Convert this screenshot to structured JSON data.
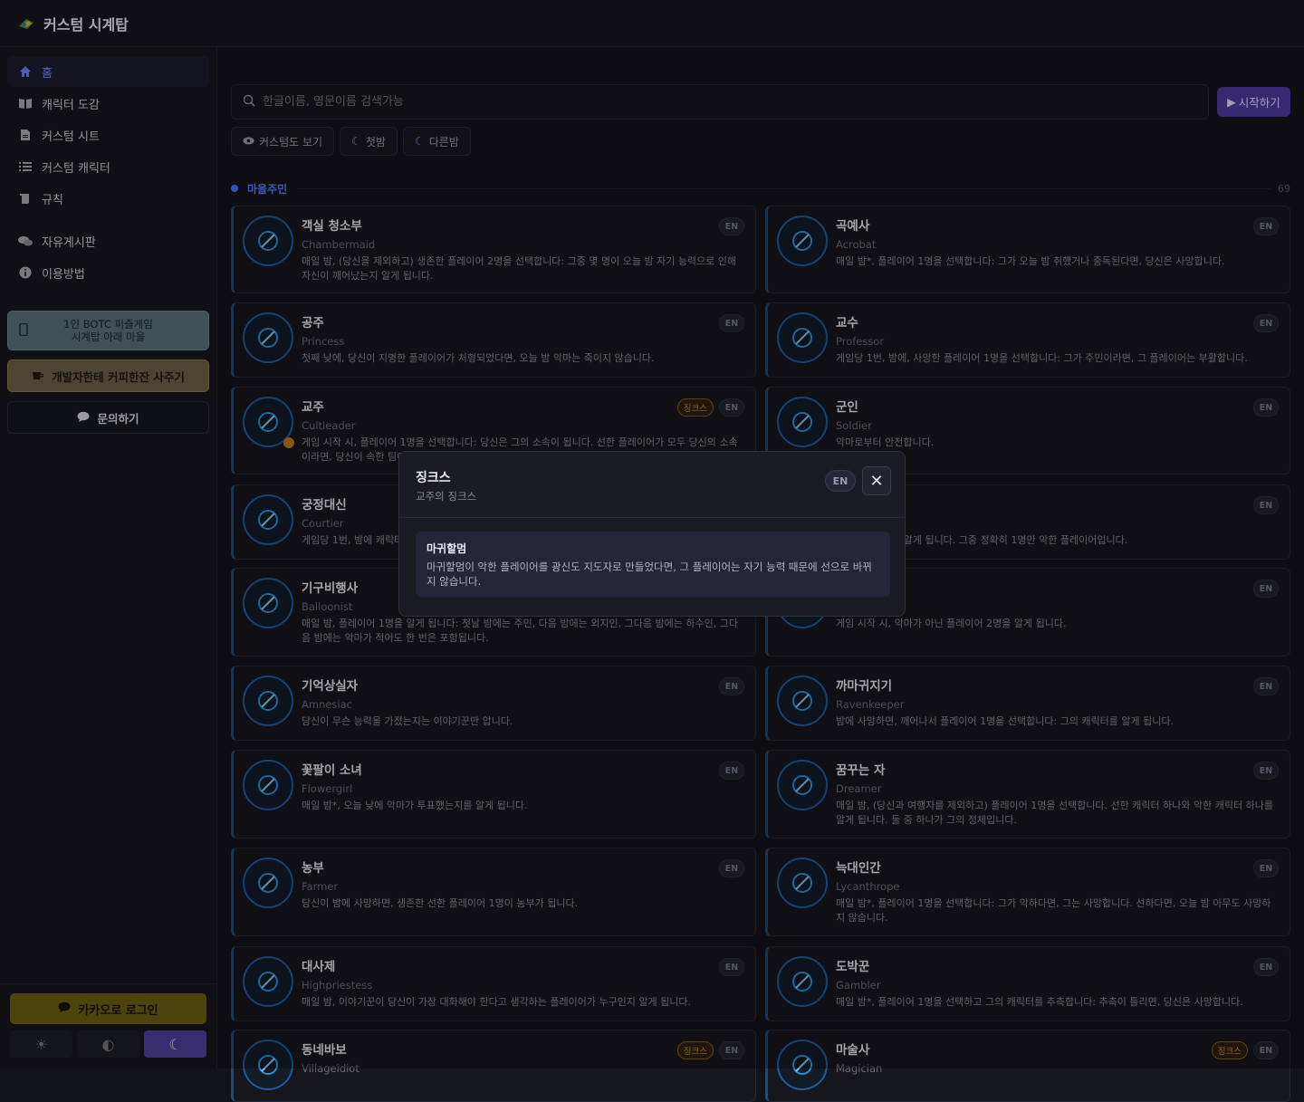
{
  "app": {
    "title": "커스텀 시계탑"
  },
  "sidebar": {
    "items": [
      {
        "label": "홈",
        "icon": "home-icon"
      },
      {
        "label": "캐릭터 도감",
        "icon": "book-icon"
      },
      {
        "label": "커스텀 시트",
        "icon": "document-icon"
      },
      {
        "label": "커스텀 캐릭터",
        "icon": "list-icon"
      },
      {
        "label": "규칙",
        "icon": "scroll-icon"
      },
      {
        "label": "자유게시판",
        "icon": "chat-icon"
      },
      {
        "label": "이용방법",
        "icon": "info-icon"
      }
    ],
    "promo1_line1": "1인 BOTC 퍼즐게임",
    "promo1_line2": "시계탑 아래 마을",
    "promo2": "개발자한테 커피한잔 사주기",
    "promo3": "문의하기",
    "kakao_login": "카카오로 로그인"
  },
  "search": {
    "placeholder": "한글이름, 영문이름 검색가능"
  },
  "start_button": "시작하기",
  "filters": [
    "커스텀도 보기",
    "첫밤",
    "다른밤"
  ],
  "section": {
    "label": "마을주민",
    "count": "69"
  },
  "cards": [
    {
      "name": "객실 청소부",
      "en": "Chambermaid",
      "desc": "매일 밤, (당신을 제외하고) 생존한 플레이어 2명을 선택합니다: 그중 몇 명이 오늘 밤 자기 능력으로 인해 자신이 깨어났는지 알게 됩니다.",
      "jinx": ""
    },
    {
      "name": "곡예사",
      "en": "Acrobat",
      "desc": "매일 밤*, 플레이어 1명을 선택합니다: 그가 오늘 밤 취했거나 중독된다면, 당신은 사망합니다.",
      "jinx": ""
    },
    {
      "name": "공주",
      "en": "Princess",
      "desc": "첫째 낮에, 당신이 지명한 플레이어가 처형되었다면, 오늘 밤 악마는 죽이지 않습니다.",
      "jinx": ""
    },
    {
      "name": "교수",
      "en": "Professor",
      "desc": "게임당 1번, 밤에, 사망한 플레이어 1명을 선택합니다: 그가 주민이라면, 그 플레이어는 부활합니다.",
      "jinx": ""
    },
    {
      "name": "교주",
      "en": "Cultleader",
      "desc": "게임 시작 시, 플레이어 1명을 선택합니다: 당신은 그의 소속이 됩니다. 선한 플레이어가 모두 당신의 소속 이라면, 당신이 속한 팀이",
      "jinx": "징크스"
    },
    {
      "name": "군인",
      "en": "Soldier",
      "desc": "악마로부터 안전합니다.",
      "jinx": ""
    },
    {
      "name": "궁정대신",
      "en": "Courtier",
      "desc": "게임당 1번, 밤에 캐릭터",
      "jinx": ""
    },
    {
      "name": "",
      "en": "",
      "desc": "플레이어 3명을 알게 됩니다. 그중 정확히 1명만 악한 플레이어입니다.",
      "jinx": ""
    },
    {
      "name": "기구비행사",
      "en": "Balloonist",
      "desc": "매일 밤, 플레이어 1명을 알게 됩니다: 첫날 밤에는 주민, 다음 밤에는 외지인, 그다음 밤에는 하수인, 그다 음 밤에는 악마가 적어도 한 번은 포함됩니다.",
      "jinx": ""
    },
    {
      "name": "",
      "en": "",
      "desc": "게임 시작 시, 악마가 아닌 플레이어 2명을 알게 됩니다.",
      "jinx": ""
    },
    {
      "name": "기억상실자",
      "en": "Amnesiac",
      "desc": "당신이 무슨 능력을 가졌는지는 이야기꾼만 압니다.",
      "jinx": ""
    },
    {
      "name": "까마귀지기",
      "en": "Ravenkeeper",
      "desc": "밤에 사망하면, 깨어나서 플레이어 1명을 선택합니다: 그의 캐릭터를 알게 됩니다.",
      "jinx": ""
    },
    {
      "name": "꽃팔이 소녀",
      "en": "Flowergirl",
      "desc": "매일 밤*, 오늘 낮에 악마가 투표했는지를 알게 됩니다.",
      "jinx": ""
    },
    {
      "name": "꿈꾸는 자",
      "en": "Dreamer",
      "desc": "매일 밤, (당신과 여행자를 제외하고) 플레이어 1명을 선택합니다. 선한 캐릭터 하나와 악한 캐릭터 하나를 알게 됩니다. 둘 중 하나가 그의 정체입니다.",
      "jinx": ""
    },
    {
      "name": "농부",
      "en": "Farmer",
      "desc": "당신이 밤에 사망하면, 생존한 선한 플레이어 1명이 농부가 됩니다.",
      "jinx": ""
    },
    {
      "name": "늑대인간",
      "en": "Lycanthrope",
      "desc": "매일 밤*, 플레이어 1명을 선택합니다: 그가 악하다면, 그는 사망합니다. 선하다면, 오늘 밤 아무도 사망하 지 않습니다.",
      "jinx": ""
    },
    {
      "name": "대사제",
      "en": "Highpriestess",
      "desc": "매일 밤, 이야기꾼이 당신이 가장 대화해야 한다고 생각하는 플레이어가 누구인지 알게 됩니다.",
      "jinx": ""
    },
    {
      "name": "도박꾼",
      "en": "Gambler",
      "desc": "매일 밤*, 플레이어 1명을 선택하고 그의 캐릭터를 추측합니다: 추측이 틀리면, 당신은 사망합니다.",
      "jinx": ""
    },
    {
      "name": "동네바보",
      "en": "Villageidiot",
      "desc": "",
      "jinx": "징크스"
    },
    {
      "name": "마술사",
      "en": "Magician",
      "desc": "",
      "jinx": "징크스"
    }
  ],
  "en_badge": "EN",
  "modal": {
    "title": "징크스",
    "subtitle": "교주의 징크스",
    "en": "EN",
    "jinx_name": "마귀할멈",
    "jinx_desc": "마귀할멈이 악한 플레이어를 광신도 지도자로 만들었다면, 그 플레이어는 자기 능력 때문에 선으로 바뀌 지 않습니다."
  },
  "colors": {
    "accent": "#4b6fff",
    "card_border": "#1c4a7a",
    "jinx": "#c68a2c"
  }
}
